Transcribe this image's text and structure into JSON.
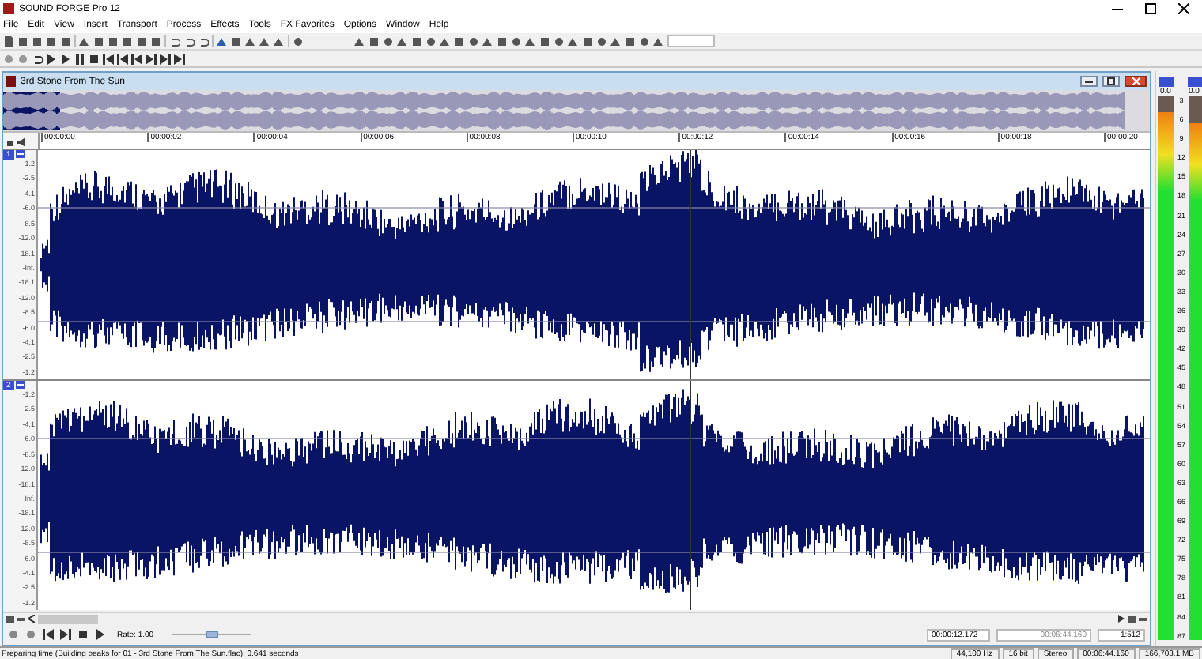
{
  "window": {
    "title": "SOUND FORGE Pro 12"
  },
  "menu": [
    "File",
    "Edit",
    "View",
    "Insert",
    "Transport",
    "Process",
    "Effects",
    "Tools",
    "FX Favorites",
    "Options",
    "Window",
    "Help"
  ],
  "data_window": {
    "title": "3rd Stone From The Sun",
    "time_ruler": [
      "00:00:00",
      "00:00:02",
      "00:00:04",
      "00:00:06",
      "00:00:08",
      "00:00:10",
      "00:00:12",
      "00:00:14",
      "00:00:16",
      "00:00:18",
      "00:00:20"
    ],
    "channels": [
      {
        "badge": "1",
        "scale": [
          "-1.2",
          "-2.5",
          "-4.1",
          "-6.0",
          "-8.5",
          "-12.0",
          "-18.1",
          "-Inf.",
          "-18.1",
          "-12.0",
          "-8.5",
          "-6.0",
          "-4.1",
          "-2.5",
          "-1.2"
        ]
      },
      {
        "badge": "2",
        "scale": [
          "-1.2",
          "-2.5",
          "-4.1",
          "-6.0",
          "-8.5",
          "-12.0",
          "-18.1",
          "-Inf.",
          "-18.1",
          "-12.0",
          "-8.5",
          "-6.0",
          "-4.1",
          "-2.5",
          "-1.2"
        ]
      }
    ],
    "rate_label": "Rate: 1.00",
    "rate_slider": {
      "level": 0.5
    },
    "cursor_position": "00:00:12.172",
    "selection_length": "00:06:44.160",
    "zoom_ratio": "1:512"
  },
  "meters": {
    "peaks": [
      "0.0",
      "0.0"
    ],
    "levels": [
      {
        "level": 0.97
      },
      {
        "level": 0.95
      }
    ],
    "scale": [
      "3",
      "6",
      "9",
      "12",
      "15",
      "18",
      "21",
      "24",
      "27",
      "30",
      "33",
      "36",
      "39",
      "42",
      "45",
      "48",
      "51",
      "54",
      "57",
      "60",
      "63",
      "66",
      "69",
      "72",
      "75",
      "78",
      "81",
      "84",
      "87"
    ]
  },
  "status_bar": {
    "message": "Preparing time (Building peaks for 01 - 3rd Stone From The Sun.flac): 0.641 seconds",
    "fields": [
      "44,100 Hz",
      "16 bit",
      "Stereo",
      "00:06:44.160",
      "166,703.1 MB"
    ]
  }
}
